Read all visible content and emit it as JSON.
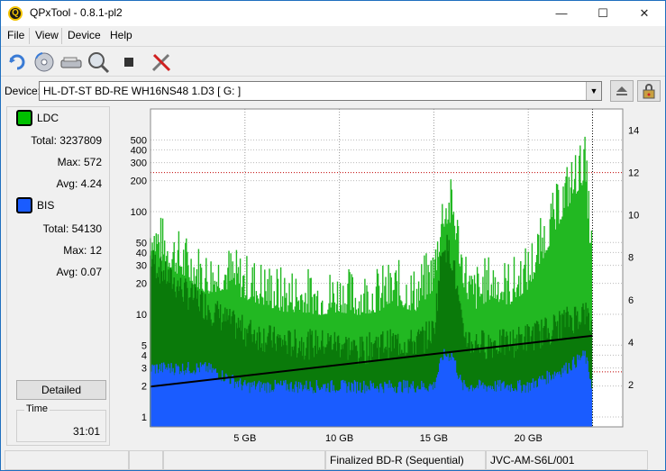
{
  "window": {
    "title": "QPxTool - 0.8.1-pl2",
    "app_icon_letter": "Q",
    "minimize_glyph": "—",
    "maximize_glyph": "☐",
    "close_glyph": "✕"
  },
  "menu": {
    "file": "File",
    "view": "View",
    "device": "Device",
    "help": "Help"
  },
  "toolbar": {
    "buttons": [
      "refresh-icon",
      "disc-scan-icon",
      "drive-info-icon",
      "magnifier-disc-icon",
      "stop-icon",
      "settings-tools-icon"
    ]
  },
  "device": {
    "label": "Device:",
    "selected": "HL-DT-ST BD-RE  WH16NS48  1.D3 [ G: ]"
  },
  "stats": {
    "ldc": {
      "name": "LDC",
      "color": "#00c000",
      "total_label": "Total:",
      "total": "3237809",
      "max_label": "Max:",
      "max": "572",
      "avg_label": "Avg:",
      "avg": "4.24"
    },
    "bis": {
      "name": "BIS",
      "color": "#1a5cff",
      "total_label": "Total:",
      "total": "54130",
      "max_label": "Max:",
      "max": "12",
      "avg_label": "Avg:",
      "avg": "0.07"
    },
    "detailed_label": "Detailed",
    "time_label": "Time",
    "time_value": "31:01"
  },
  "status": {
    "cell1": "",
    "cell2": "",
    "disc_type": "Finalized BD-R (Sequential)",
    "media_id": "JVC-AM-S6L/001"
  },
  "chart_data": {
    "type": "area",
    "x_unit": "GB",
    "x_range": [
      0,
      25
    ],
    "x_ticks": [
      5,
      10,
      15,
      20
    ],
    "x_tick_labels": [
      "5 GB",
      "10 GB",
      "15 GB",
      "20 GB"
    ],
    "y_left_scale": "log",
    "y_left_range": [
      0.8,
      1000
    ],
    "y_left_ticks": [
      1,
      2,
      3,
      4,
      5,
      10,
      20,
      30,
      40,
      50,
      100,
      200,
      300,
      400,
      500
    ],
    "y_right_range": [
      0,
      15
    ],
    "y_right_ticks": [
      2,
      4,
      6,
      8,
      10,
      12,
      14
    ],
    "grid": true,
    "series": [
      {
        "name": "LDC",
        "color": "#00b400",
        "x": [
          0,
          1,
          2,
          3,
          4,
          5,
          6,
          7,
          8,
          9,
          10,
          11,
          12,
          13,
          14,
          15,
          15.5,
          16,
          16.5,
          17,
          18,
          19,
          20,
          21,
          22,
          23,
          23.4
        ],
        "peak": [
          120,
          80,
          60,
          45,
          50,
          40,
          35,
          30,
          30,
          28,
          30,
          28,
          30,
          35,
          30,
          50,
          200,
          220,
          60,
          30,
          40,
          35,
          50,
          120,
          300,
          570,
          60
        ],
        "base": [
          40,
          25,
          18,
          14,
          10,
          8,
          7,
          6,
          6,
          6,
          6,
          5,
          6,
          6,
          6,
          8,
          60,
          40,
          8,
          6,
          6,
          6,
          7,
          8,
          10,
          12,
          8
        ]
      },
      {
        "name": "BIS",
        "color": "#1a5cff",
        "x": [
          0,
          3,
          5,
          10,
          15,
          15.5,
          16,
          16.5,
          20,
          22,
          23,
          23.4
        ],
        "values": [
          3,
          3,
          2,
          2,
          2,
          4,
          4,
          2,
          2,
          3,
          4,
          2
        ]
      },
      {
        "name": "Read speed",
        "color": "#000000",
        "axis": "right",
        "x": [
          0,
          23.4
        ],
        "values": [
          1.9,
          4.3
        ]
      }
    ]
  }
}
